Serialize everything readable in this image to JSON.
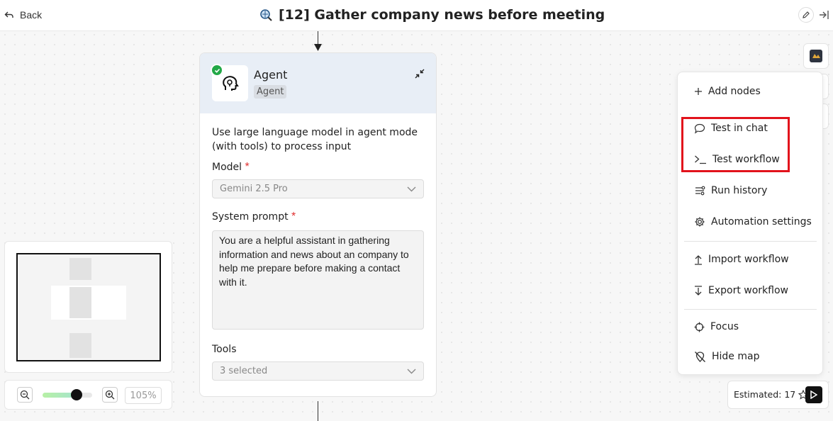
{
  "header": {
    "back_label": "Back",
    "title": "[12] Gather company news before meeting",
    "title_icon": "search-globe-icon",
    "edit_icon": "edit-icon",
    "collapse_icon": "collapse-right-icon"
  },
  "agent_node": {
    "name": "Agent",
    "tag": "Agent",
    "status": "success",
    "description": "Use large language model in agent mode (with tools) to process input",
    "model_label": "Model",
    "model_value": "Gemini 2.5 Pro",
    "prompt_label": "System prompt",
    "prompt_value": "You are a helpful assistant in gathering information and news about an company to help me prepare before making a contact with it.",
    "tools_label": "Tools",
    "tools_value": "3 selected",
    "required_marker": "*"
  },
  "zoom": {
    "level_text": "105%",
    "slider_fraction": 0.68
  },
  "side_buttons": [
    "app-icon",
    "mail-icon",
    "lightbulb-icon"
  ],
  "menu": {
    "add_nodes": "Add nodes",
    "test_in_chat": "Test in chat",
    "test_workflow": "Test workflow",
    "run_history": "Run history",
    "automation_settings": "Automation settings",
    "import_workflow": "Import workflow",
    "export_workflow": "Export workflow",
    "focus": "Focus",
    "hide_map": "Hide map"
  },
  "estimate": {
    "label": "Estimated: 17"
  },
  "colors": {
    "highlight": "#e2131c",
    "success": "#22a847",
    "node_header": "#e8eef6"
  }
}
